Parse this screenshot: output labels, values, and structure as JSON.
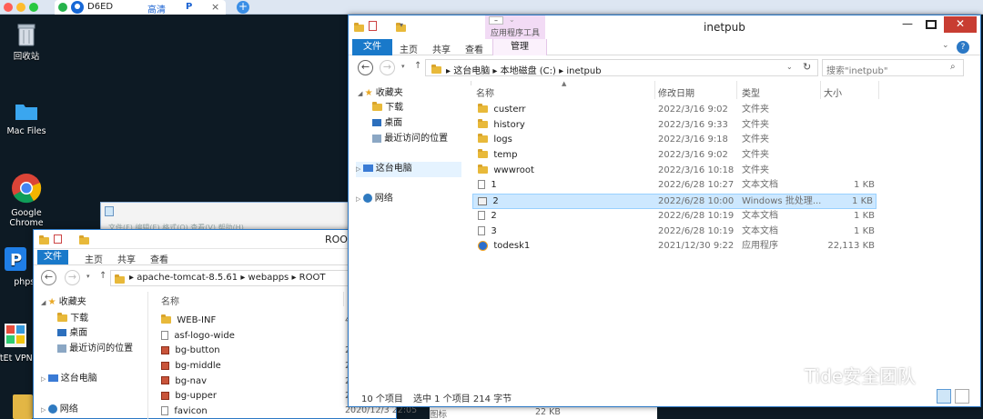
{
  "client": {
    "tab_device": "D6ED",
    "tab_quality": "高清",
    "tab_p": "P",
    "tab_close": "×",
    "newtab": "+"
  },
  "desktop": {
    "icons": [
      {
        "label": "回收站"
      },
      {
        "label": "Mac Files"
      },
      {
        "label": "Google Chrome"
      },
      {
        "label": "phpstu"
      },
      {
        "label": "SoftEt VPN Cl"
      }
    ]
  },
  "back_window": {
    "menu": "文件(F)   编辑(E)   格式(O)   查看(V)   帮助(H)"
  },
  "root_window": {
    "title": "ROOT",
    "ribbon_tabs": [
      "文件",
      "主页",
      "共享",
      "查看"
    ],
    "breadcrumb": [
      "apache-tomcat-8.5.61",
      "webapps",
      "ROOT"
    ],
    "nav": [
      "收藏夹",
      "下载",
      "桌面",
      "最近访问的位置",
      "这台电脑",
      "网络"
    ],
    "column_name": "名称",
    "files": [
      {
        "name": "WEB-INF",
        "kind": "folder"
      },
      {
        "name": "asf-logo-wide",
        "kind": "file"
      },
      {
        "name": "bg-button",
        "kind": "img"
      },
      {
        "name": "bg-middle",
        "kind": "img"
      },
      {
        "name": "bg-nav",
        "kind": "img"
      },
      {
        "name": "bg-upper",
        "kind": "img"
      },
      {
        "name": "favicon",
        "kind": "file",
        "date": "2020/12/3 22:05",
        "type": "图标",
        "size": "22 KB"
      }
    ],
    "right_marks": [
      "4",
      "2",
      "2",
      "2",
      "2",
      "2"
    ]
  },
  "inetpub_window": {
    "title": "inetpub",
    "context_tab": "应用程序工具",
    "ribbon_tabs": [
      "文件",
      "主页",
      "共享",
      "查看",
      "管理"
    ],
    "breadcrumb": [
      "这台电脑",
      "本地磁盘 (C:)",
      "inetpub"
    ],
    "search_placeholder": "搜索\"inetpub\"",
    "nav": {
      "favorites": "收藏夹",
      "downloads": "下载",
      "desktop": "桌面",
      "recent": "最近访问的位置",
      "this_pc": "这台电脑",
      "network": "网络"
    },
    "columns": {
      "name": "名称",
      "date": "修改日期",
      "type": "类型",
      "size": "大小"
    },
    "files": [
      {
        "name": "custerr",
        "date": "2022/3/16 9:02",
        "type": "文件夹",
        "size": "",
        "kind": "folder"
      },
      {
        "name": "history",
        "date": "2022/3/16 9:33",
        "type": "文件夹",
        "size": "",
        "kind": "folder"
      },
      {
        "name": "logs",
        "date": "2022/3/16 9:18",
        "type": "文件夹",
        "size": "",
        "kind": "folder"
      },
      {
        "name": "temp",
        "date": "2022/3/16 9:02",
        "type": "文件夹",
        "size": "",
        "kind": "folder"
      },
      {
        "name": "wwwroot",
        "date": "2022/3/16 10:18",
        "type": "文件夹",
        "size": "",
        "kind": "folder"
      },
      {
        "name": "1",
        "date": "2022/6/28 10:27",
        "type": "文本文档",
        "size": "1 KB",
        "kind": "file"
      },
      {
        "name": "2",
        "date": "2022/6/28 10:00",
        "type": "Windows 批处理...",
        "size": "1 KB",
        "kind": "bat"
      },
      {
        "name": "2",
        "date": "2022/6/28 10:19",
        "type": "文本文档",
        "size": "1 KB",
        "kind": "file"
      },
      {
        "name": "3",
        "date": "2022/6/28 10:19",
        "type": "文本文档",
        "size": "1 KB",
        "kind": "file"
      },
      {
        "name": "todesk1",
        "date": "2021/12/30 9:22",
        "type": "应用程序",
        "size": "22,113 KB",
        "kind": "app"
      }
    ],
    "status_count": "10 个项目",
    "status_selected": "选中 1 个项目  214 字节"
  },
  "watermark": "Tide安全团队"
}
